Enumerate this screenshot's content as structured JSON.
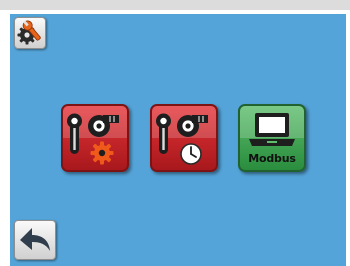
{
  "screen": {
    "colors": {
      "background": "#54a4d9",
      "tile_red": "#d42a2f",
      "tile_green": "#3fa553",
      "button_gray": "#e6e6e6"
    }
  },
  "toolbar": {
    "settings_icon": "wrench-gear-icon",
    "back_icon": "back-arrow-icon"
  },
  "tiles": [
    {
      "name": "pump-settings",
      "icons": [
        "sensor-icon",
        "pump-icon",
        "gear-icon"
      ]
    },
    {
      "name": "pump-schedule",
      "icons": [
        "sensor-icon",
        "pump-icon",
        "clock-icon"
      ]
    },
    {
      "name": "modbus",
      "icons": [
        "laptop-icon"
      ],
      "label": "Modbus"
    }
  ]
}
